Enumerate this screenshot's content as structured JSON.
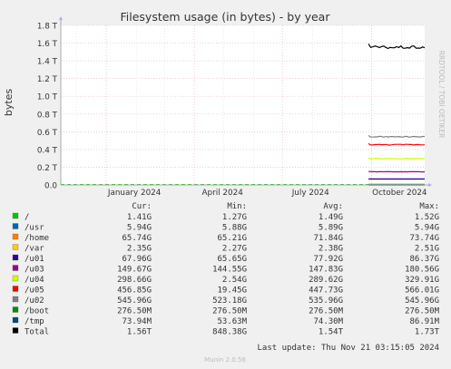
{
  "chart_data": {
    "type": "line",
    "title": "Filesystem usage (in bytes) - by year",
    "ylabel": "bytes",
    "side_label": "RRDTOOL / TOBI OETIKER",
    "footer": "Munin 2.0.56",
    "ylim": [
      0,
      1.8
    ],
    "y_ticks": [
      "0.0",
      "0.2 T",
      "0.4 T",
      "0.6 T",
      "0.8 T",
      "1.0 T",
      "1.2 T",
      "1.4 T",
      "1.6 T",
      "1.8 T"
    ],
    "x_range": [
      "2023-11-15",
      "2024-11-25"
    ],
    "x_ticks": [
      {
        "label": "January 2024",
        "date": "2024-01-01"
      },
      {
        "label": "April 2024",
        "date": "2024-04-01"
      },
      {
        "label": "July 2024",
        "date": "2024-07-01"
      },
      {
        "label": "October 2024",
        "date": "2024-10-01"
      }
    ],
    "data_start": "2024-09-28",
    "grid": true,
    "table_headers": [
      "Cur:",
      "Min:",
      "Avg:",
      "Max:"
    ],
    "last_update": "Last update: Thu Nov 21 03:15:05 2024",
    "series": [
      {
        "name": "/",
        "color": "#00cc00",
        "value": 0.00141,
        "cur": "1.41G",
        "min": "1.27G",
        "avg": "1.49G",
        "max": "1.52G"
      },
      {
        "name": "/usr",
        "color": "#0066b3",
        "value": 0.00594,
        "cur": "5.94G",
        "min": "5.88G",
        "avg": "5.89G",
        "max": "5.94G"
      },
      {
        "name": "/home",
        "color": "#ff8000",
        "value": 0.0657,
        "cur": "65.74G",
        "min": "65.21G",
        "avg": "71.84G",
        "max": "73.74G"
      },
      {
        "name": "/var",
        "color": "#ffcc00",
        "value": 0.00235,
        "cur": "2.35G",
        "min": "2.27G",
        "avg": "2.38G",
        "max": "2.51G"
      },
      {
        "name": "/u01",
        "color": "#330099",
        "value": 0.068,
        "cur": "67.96G",
        "min": "65.65G",
        "avg": "77.92G",
        "max": "86.37G"
      },
      {
        "name": "/u03",
        "color": "#990099",
        "value": 0.1497,
        "cur": "149.67G",
        "min": "144.55G",
        "avg": "147.83G",
        "max": "180.56G"
      },
      {
        "name": "/u04",
        "color": "#ccff00",
        "value": 0.2987,
        "cur": "298.66G",
        "min": "2.54G",
        "avg": "289.62G",
        "max": "329.91G"
      },
      {
        "name": "/u05",
        "color": "#ff0000",
        "value": 0.4569,
        "cur": "456.85G",
        "min": "19.45G",
        "avg": "447.73G",
        "max": "566.01G"
      },
      {
        "name": "/u02",
        "color": "#808080",
        "value": 0.546,
        "cur": "545.96G",
        "min": "523.18G",
        "avg": "535.96G",
        "max": "545.96G"
      },
      {
        "name": "/boot",
        "color": "#008f00",
        "value": 0.000277,
        "cur": "276.50M",
        "min": "276.50M",
        "avg": "276.50M",
        "max": "276.50M"
      },
      {
        "name": "/tmp",
        "color": "#00487d",
        "value": 7.39e-05,
        "cur": "73.94M",
        "min": "53.63M",
        "avg": "74.30M",
        "max": "86.91M"
      },
      {
        "name": "Total",
        "color": "#000000",
        "value": 1.56,
        "cur": "1.56T",
        "min": "848.38G",
        "avg": "1.54T",
        "max": "1.73T"
      }
    ]
  }
}
